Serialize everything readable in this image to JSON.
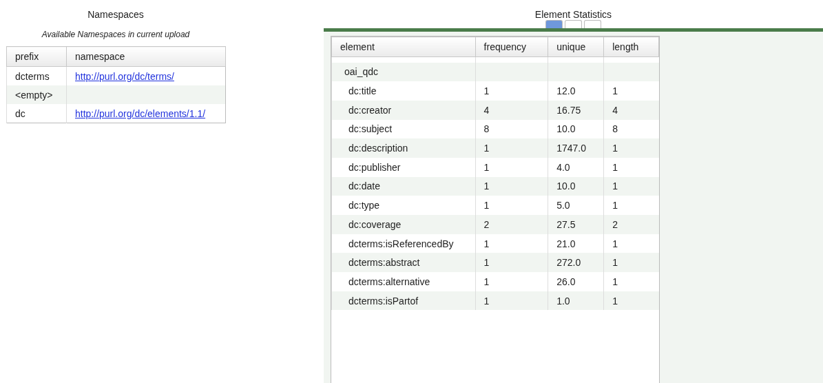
{
  "namespaces": {
    "title": "Namespaces",
    "caption": "Available Namespaces in current upload",
    "columns": [
      "prefix",
      "namespace"
    ],
    "rows": [
      {
        "prefix": "dcterms",
        "namespace": "http://purl.org/dc/terms/"
      },
      {
        "prefix": "<empty>"
      },
      {
        "prefix": "dc",
        "namespace": "http://purl.org/dc/elements/1.1/"
      }
    ]
  },
  "statistics": {
    "title": "Element Statistics",
    "tabs": [
      {
        "selected": true
      },
      {
        "selected": false
      },
      {
        "selected": false
      }
    ],
    "columns": [
      "element",
      "frequency",
      "unique",
      "length"
    ],
    "tree": [
      {
        "element": "oai_qdc",
        "children": [
          {
            "element": "dc:title",
            "frequency": "1",
            "unique": "12.0",
            "length": "1"
          },
          {
            "element": "dc:creator",
            "frequency": "4",
            "unique": "16.75",
            "length": "4"
          },
          {
            "element": "dc:subject",
            "frequency": "8",
            "unique": "10.0",
            "length": "8"
          },
          {
            "element": "dc:description",
            "frequency": "1",
            "unique": "1747.0",
            "length": "1"
          },
          {
            "element": "dc:publisher",
            "frequency": "1",
            "unique": "4.0",
            "length": "1"
          },
          {
            "element": "dc:date",
            "frequency": "1",
            "unique": "10.0",
            "length": "1"
          },
          {
            "element": "dc:type",
            "frequency": "1",
            "unique": "5.0",
            "length": "1"
          },
          {
            "element": "dc:coverage",
            "frequency": "2",
            "unique": "27.5",
            "length": "2"
          },
          {
            "element": "dcterms:isReferencedBy",
            "frequency": "1",
            "unique": "21.0",
            "length": "1"
          },
          {
            "element": "dcterms:abstract",
            "frequency": "1",
            "unique": "272.0",
            "length": "1"
          },
          {
            "element": "dcterms:alternative",
            "frequency": "1",
            "unique": "26.0",
            "length": "1"
          },
          {
            "element": "dcterms:isPartof",
            "frequency": "1",
            "unique": "1.0",
            "length": "1"
          }
        ]
      }
    ]
  }
}
